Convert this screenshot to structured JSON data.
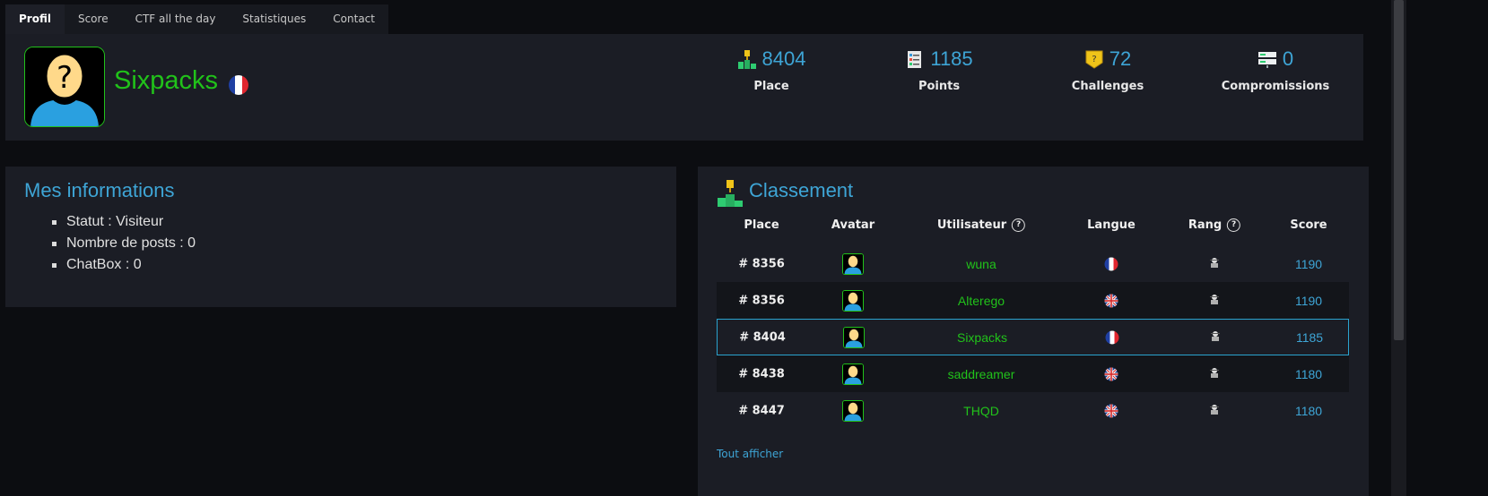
{
  "tabs": [
    {
      "label": "Profil",
      "active": true
    },
    {
      "label": "Score",
      "active": false
    },
    {
      "label": "CTF all the day",
      "active": false
    },
    {
      "label": "Statistiques",
      "active": false
    },
    {
      "label": "Contact",
      "active": false
    }
  ],
  "profile": {
    "username": "Sixpacks",
    "country_flag": "fr-flag-icon",
    "avatar": "default-avatar-icon"
  },
  "stats": [
    {
      "icon": "podium-icon",
      "value": "8404",
      "label": "Place"
    },
    {
      "icon": "points-sheet-icon",
      "value": "1185",
      "label": "Points"
    },
    {
      "icon": "challenge-badge-icon",
      "value": "72",
      "label": "Challenges"
    },
    {
      "icon": "compromission-server-icon",
      "value": "0",
      "label": "Compromissions"
    }
  ],
  "info": {
    "title": "Mes informations",
    "items": [
      "Statut : Visiteur",
      "Nombre de posts : 0",
      "ChatBox : 0"
    ]
  },
  "ranking": {
    "title": "Classement",
    "headers": {
      "place": "Place",
      "avatar": "Avatar",
      "user": "Utilisateur",
      "lang": "Langue",
      "rank": "Rang",
      "score": "Score"
    },
    "help_symbol": "?",
    "rows": [
      {
        "place": "# 8356",
        "user": "wuna",
        "lang": "fr",
        "score": "1190",
        "current": false
      },
      {
        "place": "# 8356",
        "user": "Alterego",
        "lang": "uk",
        "score": "1190",
        "current": false
      },
      {
        "place": "# 8404",
        "user": "Sixpacks",
        "lang": "fr",
        "score": "1185",
        "current": true
      },
      {
        "place": "# 8438",
        "user": "saddreamer",
        "lang": "uk",
        "score": "1180",
        "current": false
      },
      {
        "place": "# 8447",
        "user": "THQD",
        "lang": "uk",
        "score": "1180",
        "current": false
      }
    ],
    "show_all": "Tout afficher"
  },
  "colors": {
    "accent_blue": "#3ea5d6",
    "username_green": "#21c21a",
    "panel_bg": "#1b1d25",
    "page_bg": "#0c0d11"
  }
}
